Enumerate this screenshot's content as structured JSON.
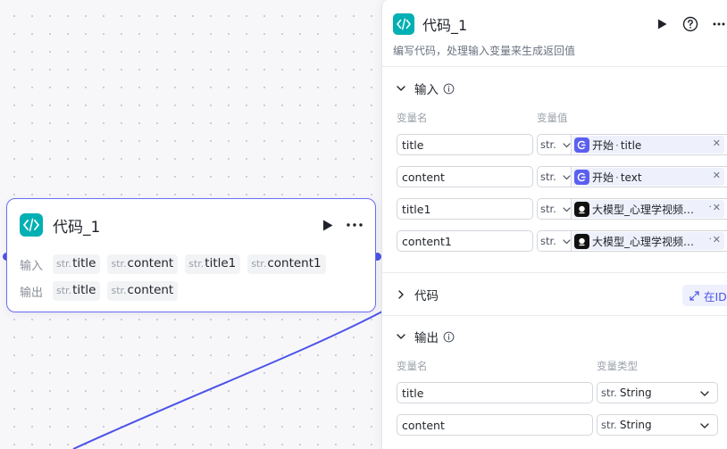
{
  "canvas": {
    "node": {
      "title": "代码_1",
      "input_label": "输入",
      "output_label": "输出",
      "type_prefix": "str.",
      "inputs": [
        "title",
        "content",
        "title1",
        "content1"
      ],
      "outputs": [
        "title",
        "content"
      ]
    }
  },
  "panel": {
    "title": "代码_1",
    "description": "编写代码，处理输入变量来生成返回值",
    "input_section": {
      "title": "输入",
      "col_name": "变量名",
      "col_value": "变量值",
      "rows": [
        {
          "name": "title",
          "type": "str.",
          "source": "开始",
          "field": "title",
          "source_icon": "start-icon"
        },
        {
          "name": "content",
          "type": "str.",
          "source": "开始",
          "field": "text",
          "source_icon": "start-icon"
        },
        {
          "name": "title1",
          "type": "str.",
          "source": "大模型_心理学视频…",
          "field": "",
          "source_icon": "llm-icon"
        },
        {
          "name": "content1",
          "type": "str.",
          "source": "大模型_心理学视频…",
          "field": "",
          "source_icon": "llm-icon"
        }
      ]
    },
    "code_section": {
      "title": "代码",
      "ide_label": "在IDE"
    },
    "output_section": {
      "title": "输出",
      "col_name": "变量名",
      "col_type": "变量类型",
      "rows": [
        {
          "name": "title",
          "type_prefix": "str.",
          "type": "String"
        },
        {
          "name": "content",
          "type_prefix": "str.",
          "type": "String"
        }
      ]
    }
  },
  "colors": {
    "accent": "#4d53e8",
    "code_icon_bg": "#00b0b3",
    "node_border": "#6b6df0"
  }
}
